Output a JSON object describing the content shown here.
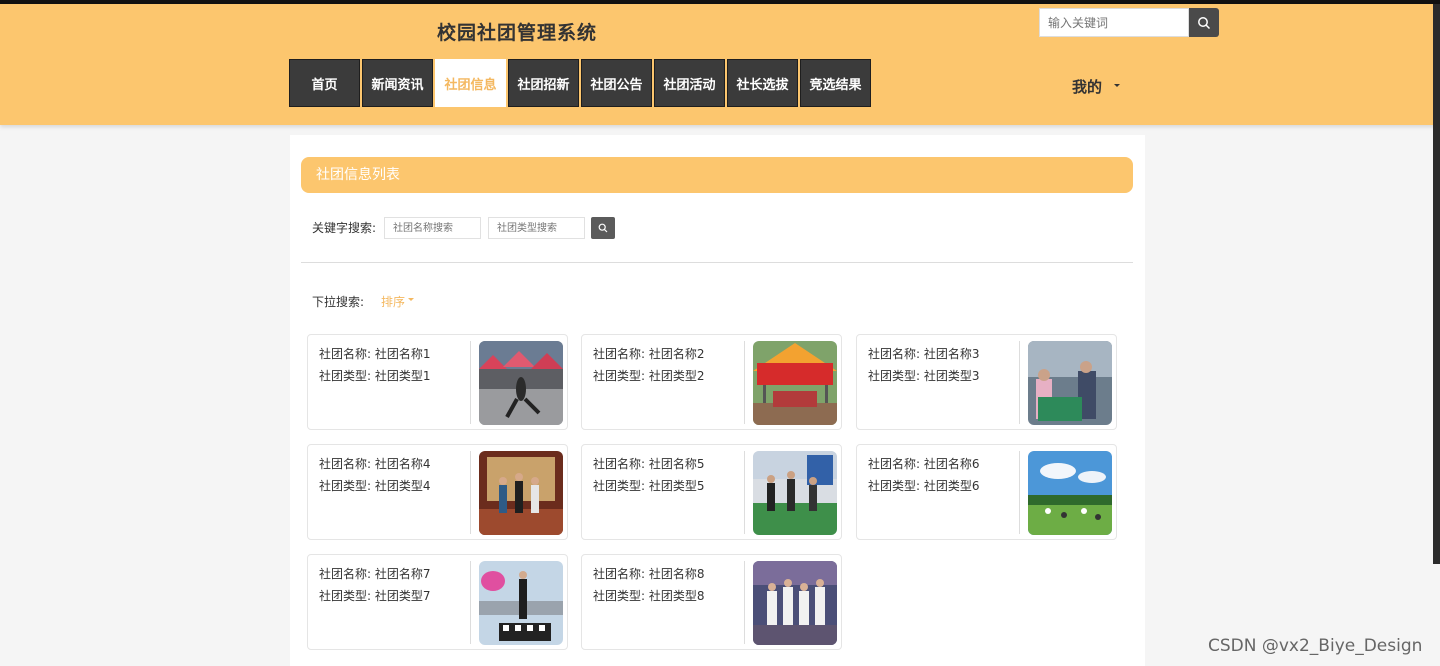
{
  "site_title": "校园社团管理系统",
  "search": {
    "placeholder": "输入关键词"
  },
  "nav": [
    "首页",
    "新闻资讯",
    "社团信息",
    "社团招新",
    "社团公告",
    "社团活动",
    "社长选拔",
    "竞选结果"
  ],
  "nav_active_index": 2,
  "user_menu": "我的",
  "list_title": "社团信息列表",
  "filters": {
    "keyword_label": "关键字搜索:",
    "name_placeholder": "社团名称搜索",
    "type_placeholder": "社团类型搜索",
    "dropdown_label": "下拉搜索:",
    "sort_label": "排序"
  },
  "cards": [
    {
      "name": "社团名称: 社团名称1",
      "type": "社团类型: 社团类型1"
    },
    {
      "name": "社团名称: 社团名称2",
      "type": "社团类型: 社团类型2"
    },
    {
      "name": "社团名称: 社团名称3",
      "type": "社团类型: 社团类型3"
    },
    {
      "name": "社团名称: 社团名称4",
      "type": "社团类型: 社团类型4"
    },
    {
      "name": "社团名称: 社团名称5",
      "type": "社团类型: 社团类型5"
    },
    {
      "name": "社团名称: 社团名称6",
      "type": "社团类型: 社团类型6"
    },
    {
      "name": "社团名称: 社团名称7",
      "type": "社团类型: 社团类型7"
    },
    {
      "name": "社团名称: 社团名称8",
      "type": "社团类型: 社团类型8"
    }
  ],
  "watermark": "CSDN @vx2_Biye_Design",
  "colors": {
    "accent": "#fcc66e",
    "nav_bg": "#3b3b3b",
    "active_text": "#f4b860"
  }
}
